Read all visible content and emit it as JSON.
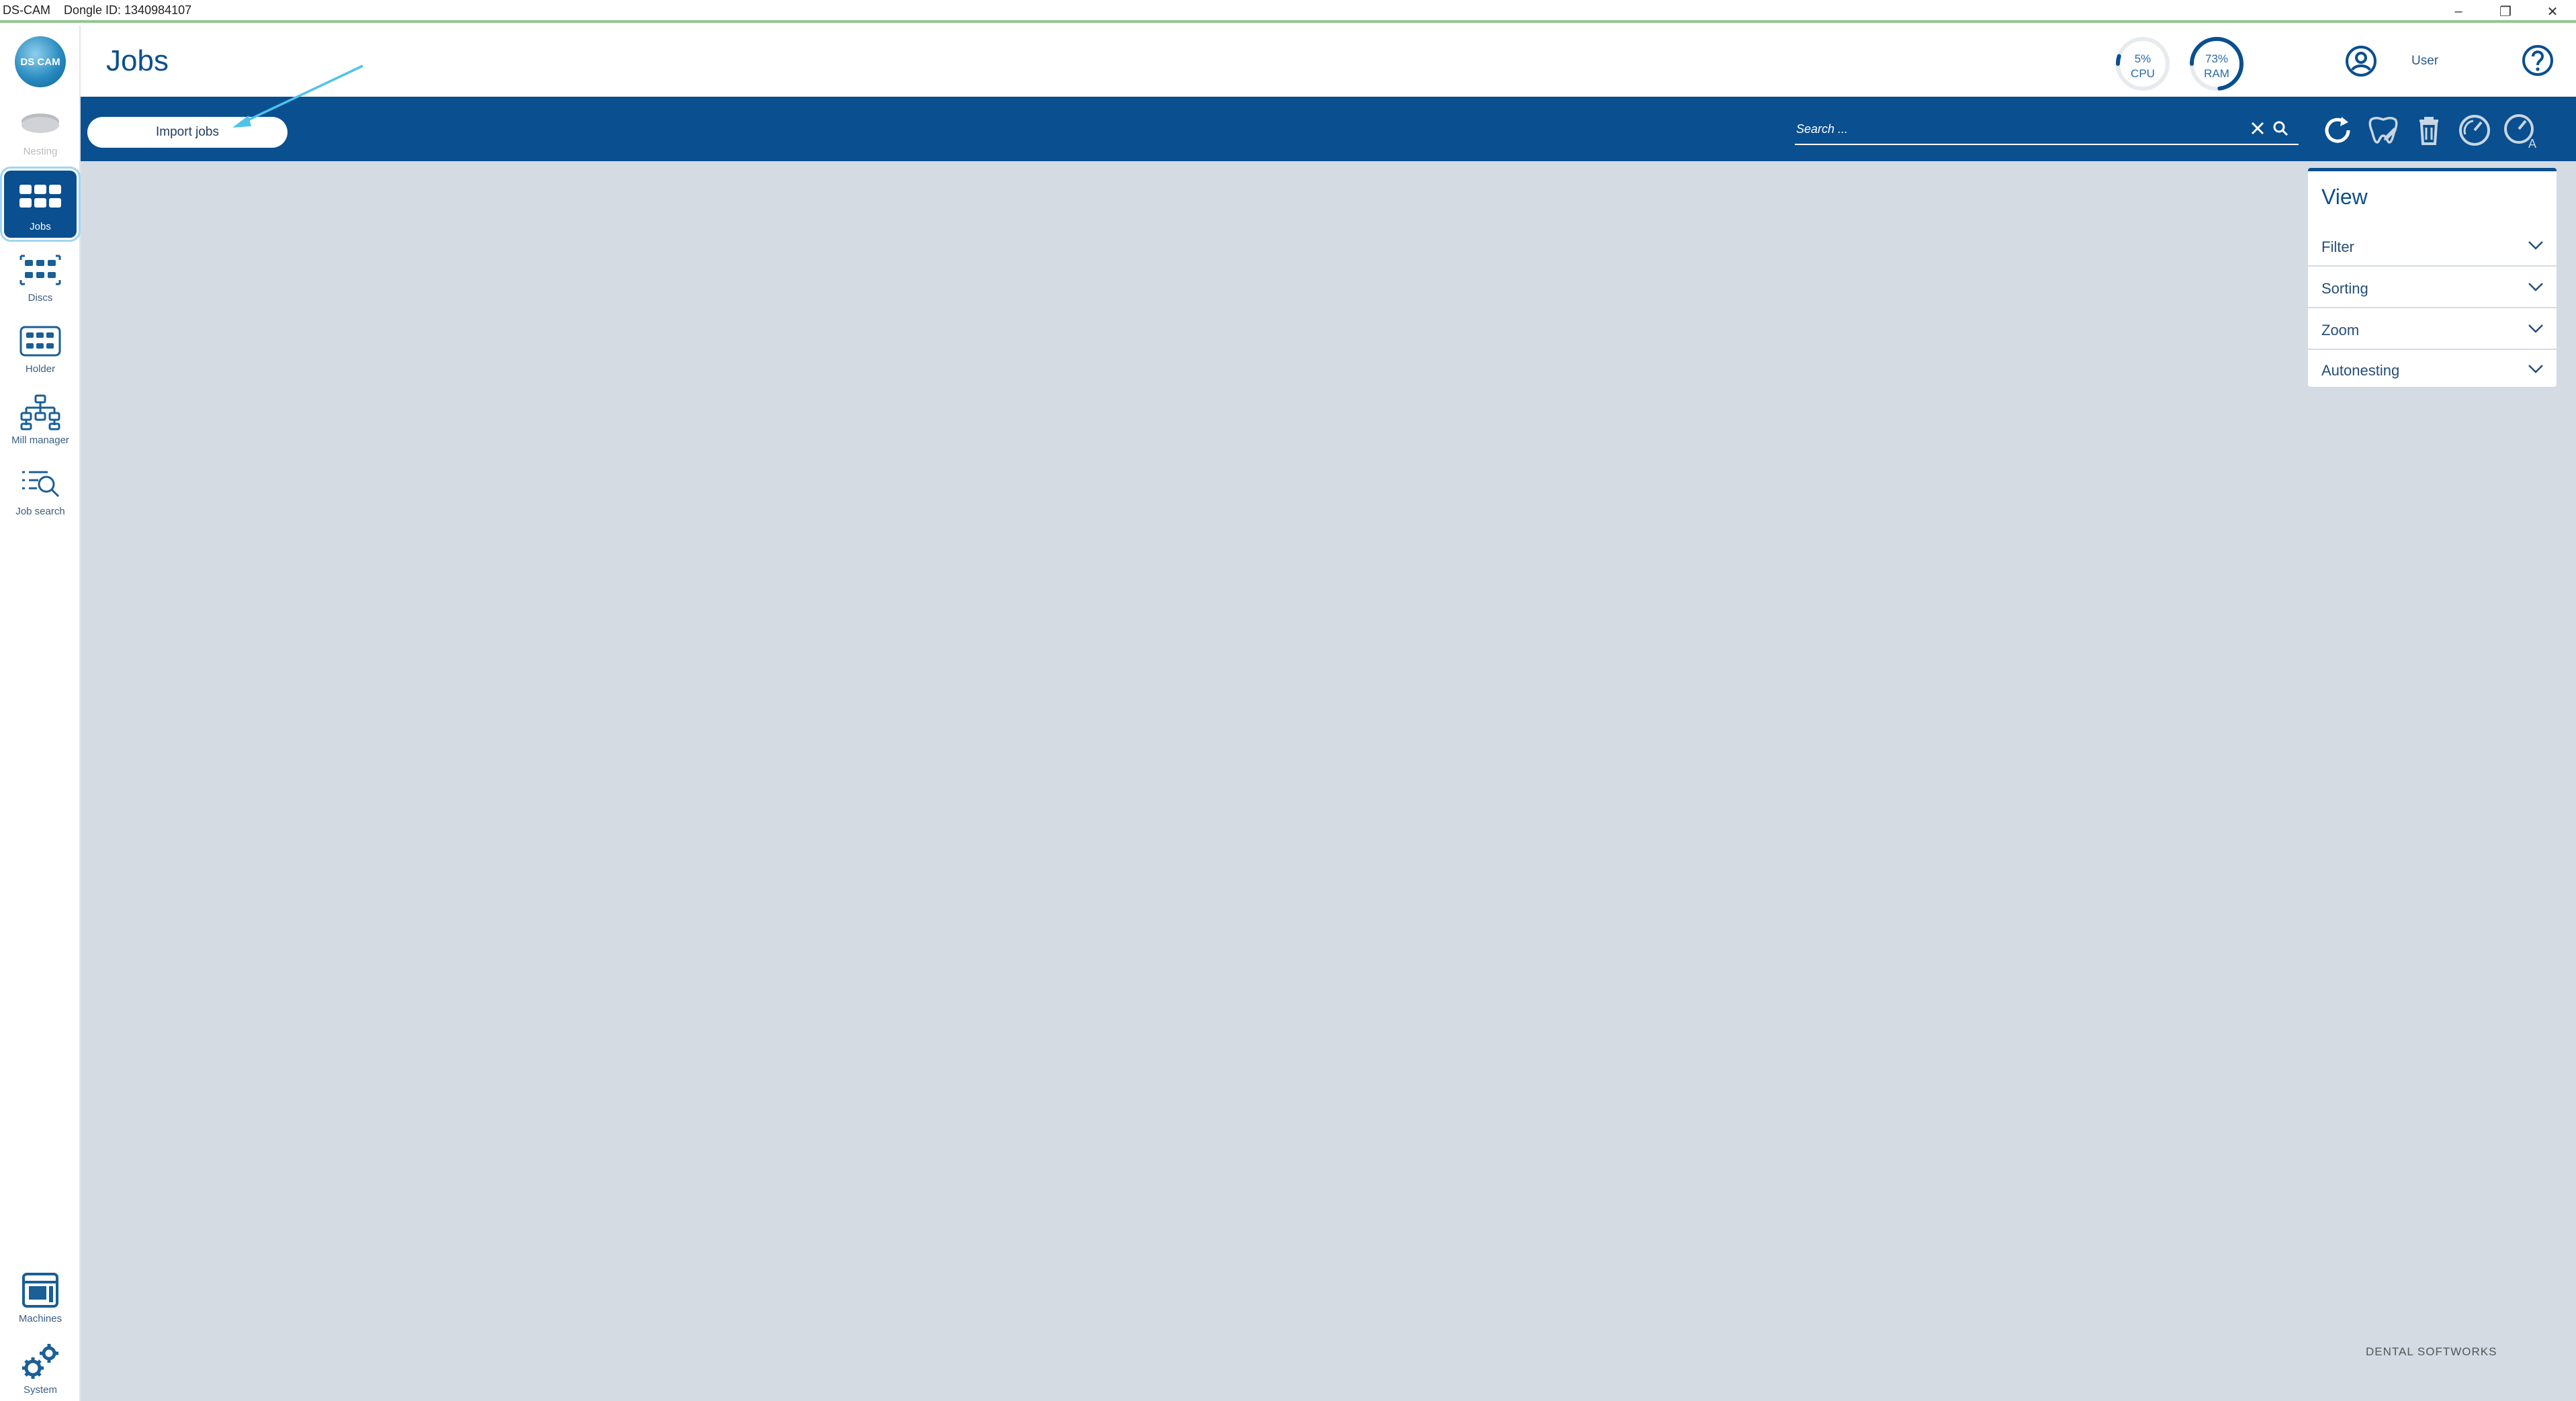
{
  "window": {
    "title": "DS-CAM    Dongle ID: 1340984107",
    "controls": {
      "minimize": "–",
      "restore": "❐",
      "close": "✕"
    }
  },
  "logo": {
    "text": "DS CAM"
  },
  "sidebar": {
    "items": [
      {
        "label": "Nesting",
        "icon": "disc-icon",
        "state": "disabled"
      },
      {
        "label": "Jobs",
        "icon": "jobs-grid-icon",
        "state": "active"
      },
      {
        "label": "Discs",
        "icon": "discs-icon",
        "state": "normal"
      },
      {
        "label": "Holder",
        "icon": "holder-icon",
        "state": "normal"
      },
      {
        "label": "Mill manager",
        "icon": "mill-manager-icon",
        "state": "normal"
      },
      {
        "label": "Job search",
        "icon": "job-search-icon",
        "state": "normal"
      },
      {
        "label": "Machines",
        "icon": "machines-icon",
        "state": "normal"
      },
      {
        "label": "System",
        "icon": "gears-icon",
        "state": "normal"
      }
    ]
  },
  "header": {
    "title": "Jobs",
    "cpu": {
      "value": "5%",
      "label": "CPU",
      "percent": 5
    },
    "ram": {
      "value": "73%",
      "label": "RAM",
      "percent": 73
    },
    "user": "User",
    "accent": "#0a4f8f"
  },
  "toolbar": {
    "import_label": "Import jobs",
    "search_placeholder": "Search ...",
    "icons": [
      "refresh-icon",
      "tooth-edit-icon",
      "trash-icon",
      "gauge-icon",
      "gauge-auto-icon"
    ]
  },
  "view_panel": {
    "title": "View",
    "rows": [
      {
        "label": "Filter"
      },
      {
        "label": "Sorting"
      },
      {
        "label": "Zoom"
      },
      {
        "label": "Autonesting"
      }
    ]
  },
  "footer": {
    "brand": "DENTAL SOFTWORKS"
  }
}
